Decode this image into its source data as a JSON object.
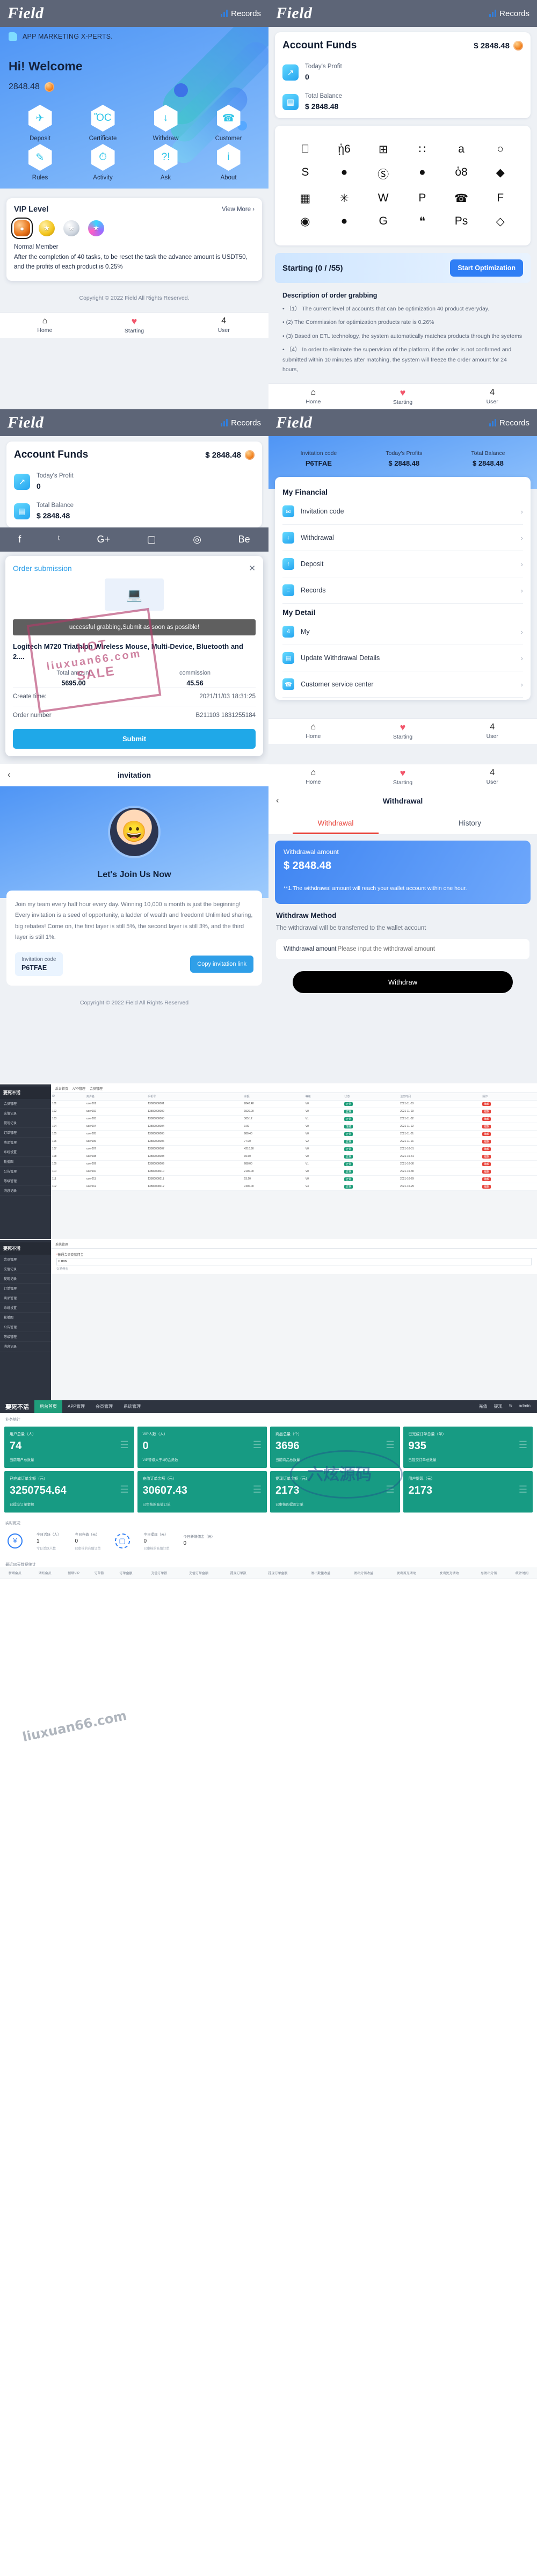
{
  "app": {
    "logo": "Field",
    "records_label": "Records",
    "tagline": "APP MARKETING X-PERTS.",
    "greeting": "Hi! Welcome",
    "balance": "2848.48",
    "copyright": "Copyright © 2022 Field All Rights Reserved."
  },
  "quick_actions": [
    {
      "label": "Deposit",
      "icon": "rocket-icon",
      "glyph": "✈"
    },
    {
      "label": "Certificate",
      "icon": "certificate-icon",
      "glyph": "ὍC"
    },
    {
      "label": "Withdraw",
      "icon": "withdraw-icon",
      "glyph": "↓"
    },
    {
      "label": "Customer",
      "icon": "customer-icon",
      "glyph": "☎"
    },
    {
      "label": "Rules",
      "icon": "rules-icon",
      "glyph": "✎"
    },
    {
      "label": "Activity",
      "icon": "activity-icon",
      "glyph": "⏱"
    },
    {
      "label": "Ask",
      "icon": "ask-icon",
      "glyph": "?!"
    },
    {
      "label": "About",
      "icon": "about-icon",
      "glyph": "i"
    }
  ],
  "vip": {
    "title": "VIP Level",
    "view_more": "View More",
    "tier": "Normal Member",
    "description": "After the completion of 40 tasks, to be reset the task the advance amount is USDT50, and the profits of each product is 0.25%",
    "medals": [
      "bronze",
      "gold",
      "silver",
      "rainbow"
    ]
  },
  "tabbar": [
    {
      "label": "Home",
      "icon": "home-icon",
      "glyph": "⌂"
    },
    {
      "label": "Starting",
      "icon": "heart-icon",
      "glyph": "♥"
    },
    {
      "label": "User",
      "icon": "user-icon",
      "glyph": "὆4"
    }
  ],
  "funds": {
    "title": "Account Funds",
    "amount": "$ 2848.48",
    "rows": [
      {
        "label": "Today's Profit",
        "value": "0",
        "icon": "chart-up-icon",
        "glyph": "↗"
      },
      {
        "label": "Total Balance",
        "value": "$ 2848.48",
        "icon": "wallet-icon",
        "glyph": "▤"
      }
    ]
  },
  "brand_icons": [
    "",
    "ᾑ6",
    "⊞",
    "∷",
    "a",
    "○",
    "S",
    "●",
    "Ⓢ",
    "●",
    "ὁ8",
    "◆",
    "▦",
    "✳",
    "W",
    "P",
    "☎",
    "F",
    "◉",
    "●",
    "G",
    "❝",
    "Ps",
    "◇"
  ],
  "starting": {
    "status": "Starting (0 / /55)",
    "button": "Start Optimization"
  },
  "order_desc": {
    "title": "Description of order grabbing",
    "items": [
      "• （1） The current level of accounts that can be optimization 40 product everyday.",
      "• (2) The Commission for optimization products rate is 0.26%",
      "• (3) Based on ETL technology, the system automatically matches products through the syetems",
      "• （4） In order to eliminate the supervision of the platform, if the order is not confirmed and submitted within 10 minutes after matching, the system will freeze the order amount for 24 hours,"
    ]
  },
  "social_icons": [
    "f",
    "ᵗ",
    "G+",
    "▢",
    "◎",
    "Be"
  ],
  "order_modal": {
    "title": "Order submission",
    "close": "✕",
    "toast": "uccessful grabbing,Submit as soon as possible!",
    "product": "Logitech M720 Triathlon Wireless Mouse, Multi-Device, Bluetooth and 2....",
    "total_amount_label": "Total amount",
    "total_amount": "5695.00",
    "commission_label": "commission",
    "commission": "45.56",
    "create_time_label": "Create time:",
    "create_time": "2021/11/03 18:31:25",
    "order_number_label": "Order number",
    "order_number": "B211103 1831255184",
    "submit": "Submit"
  },
  "user_page": {
    "invitation_code_label": "Invitation code",
    "invitation_code": "P6TFAE",
    "today_profit_label": "Today's Profits",
    "today_profit": "$ 2848.48",
    "total_balance_label": "Total Balance",
    "total_balance": "$ 2848.48",
    "financial_title": "My Financial",
    "financial_items": [
      {
        "label": "Invitation code",
        "icon": "ticket-icon",
        "glyph": "✉"
      },
      {
        "label": "Withdrawal",
        "icon": "withdraw-icon",
        "glyph": "↓"
      },
      {
        "label": "Deposit",
        "icon": "deposit-icon",
        "glyph": "↑"
      },
      {
        "label": "Records",
        "icon": "records-icon",
        "glyph": "≡"
      }
    ],
    "detail_title": "My Detail",
    "detail_items": [
      {
        "label": "My",
        "icon": "profile-icon",
        "glyph": "὆4"
      },
      {
        "label": "Update Withdrawal Details",
        "icon": "card-icon",
        "glyph": "▤"
      },
      {
        "label": "Customer service center",
        "icon": "headset-icon",
        "glyph": "☎"
      }
    ],
    "chevron": "›"
  },
  "invitation": {
    "nav_title": "invitation",
    "back": "‹",
    "heading": "Let's Join Us Now",
    "body": "Join my team every half hour every day. Winning 10,000 a month is just the beginning! Every invitation is a seed of opportunity, a ladder of wealth and freedom! Unlimited sharing, big rebates! Come on, the first layer is still 5%, the second layer is still 3%, and the third layer is still 1%.",
    "code_label": "Invitation code",
    "code_value": "P6TFAE",
    "copy_button": "Copy invitation link",
    "copyright": "Copyright © 2022 Field All Rights Reserved"
  },
  "withdrawal": {
    "nav_title": "Withdrawal",
    "back": "‹",
    "tabs": [
      "Withdrawal",
      "History"
    ],
    "active_tab": "Withdrawal",
    "amount_label": "Withdrawal amount",
    "amount_value": "$ 2848.48",
    "note": "**1.The withdrawal amount will reach your wallet account within one hour.",
    "method_title": "Withdraw Method",
    "method_sub": "The withdrawal will be transferred to the wallet account",
    "input_label": "Withdrawal amount",
    "input_placeholder": "Please input the withdrawal amount",
    "button": "Withdraw"
  },
  "watermark": {
    "latin": "liuxuan66.com",
    "hot": "HOT",
    "sale": "SALE",
    "chinese": "六炫源码"
  },
  "admin": {
    "brand": "要死不活",
    "brand_sub": "后台管理",
    "nav": [
      "后台首页",
      "APP管理",
      "会员管理",
      "系统管理"
    ],
    "nav_active": "后台首页",
    "nav_right": [
      "充值",
      "提现",
      "↻",
      "admin"
    ],
    "nav_badges": [
      "0",
      "0"
    ],
    "sidebar": [
      "会员管理",
      "充值记录",
      "提现记录",
      "订单管理",
      "商品管理",
      "系统设置",
      "轮播图",
      "公告管理",
      "等级管理",
      "消息记录"
    ],
    "stats_title": "业务统计",
    "stats": [
      {
        "label": "用户总量（人）",
        "value": "74",
        "sub": "当前用户总数量"
      },
      {
        "label": "VIP人数（人）",
        "value": "0",
        "sub": "VIP等级大于1的会员数"
      },
      {
        "label": "商品总量（个）",
        "value": "3696",
        "sub": "当前商品总数量"
      },
      {
        "label": "已完成订单总量（单）",
        "value": "935",
        "sub": "已提交订单总数量"
      },
      {
        "label": "已完成订单金额（元）",
        "value": "3250754.64",
        "sub": "已提交订单金额"
      },
      {
        "label": "充值订单金额（元）",
        "value": "30607.43",
        "sub": "已审核的充值订单"
      },
      {
        "label": "提现订单金额（元）",
        "value": "2173",
        "sub": "已审核的提现订单"
      },
      {
        "label": "用户提现（元）",
        "value": "2173",
        "sub": ""
      }
    ],
    "realtime_title": "实时概况",
    "realtime": [
      {
        "label": "今日活跃（人）",
        "value": "1",
        "sub": "今日活跃人数"
      },
      {
        "label": "今日充值（元）",
        "value": "0",
        "sub": "已审核的充值订单"
      },
      {
        "label": "今日提现（元）",
        "value": "0",
        "sub": "已审核的充值订单"
      },
      {
        "label": "今日新增佣金（元）",
        "value": "0",
        "sub": ""
      }
    ],
    "table60_title": "最近60天数据统计",
    "table60_headers": [
      "新增会员",
      "活跃会员",
      "新增VIP",
      "订单数",
      "订单金额",
      "充值订单数",
      "充值订单金额",
      "提现订单数",
      "提现订单金额",
      "发出数量收益",
      "发出分销收益",
      "发出首充活动",
      "发出复充活动",
      "总发出分销",
      "统计时间"
    ],
    "list_headers": [
      "ID",
      "用户名",
      "手机号",
      "余额",
      "等级",
      "状态",
      "注册时间",
      "操作"
    ],
    "list_rows": [
      [
        "101",
        "user001",
        "13800000001",
        "2848.48",
        "V0",
        "正常",
        "2021-11-03",
        "编辑"
      ],
      [
        "102",
        "user002",
        "13800000002",
        "1520.00",
        "V0",
        "正常",
        "2021-11-03",
        "编辑"
      ],
      [
        "103",
        "user003",
        "13800000003",
        "305.12",
        "V1",
        "正常",
        "2021-11-02",
        "编辑"
      ],
      [
        "104",
        "user004",
        "13800000004",
        "0.00",
        "V0",
        "冻结",
        "2021-11-02",
        "编辑"
      ],
      [
        "105",
        "user005",
        "13800000005",
        "980.40",
        "V0",
        "正常",
        "2021-11-01",
        "编辑"
      ],
      [
        "106",
        "user006",
        "13800000006",
        "77.00",
        "V2",
        "正常",
        "2021-11-01",
        "编辑"
      ],
      [
        "107",
        "user007",
        "13800000007",
        "4210.90",
        "V0",
        "正常",
        "2021-10-31",
        "编辑"
      ],
      [
        "108",
        "user008",
        "13800000008",
        "15.60",
        "V0",
        "正常",
        "2021-10-31",
        "编辑"
      ],
      [
        "109",
        "user009",
        "13800000009",
        "688.00",
        "V1",
        "正常",
        "2021-10-30",
        "编辑"
      ],
      [
        "110",
        "user010",
        "13800000010",
        "2100.00",
        "V0",
        "正常",
        "2021-10-30",
        "编辑"
      ],
      [
        "111",
        "user011",
        "13800000011",
        "53.20",
        "V0",
        "正常",
        "2021-10-29",
        "编辑"
      ],
      [
        "112",
        "user012",
        "13800000012",
        "7400.00",
        "V3",
        "正常",
        "2021-10-29",
        "编辑"
      ]
    ],
    "form": {
      "field_label": "普通会员交易佣金",
      "field_value": "0.006",
      "field_hint": "交易佣金"
    }
  }
}
